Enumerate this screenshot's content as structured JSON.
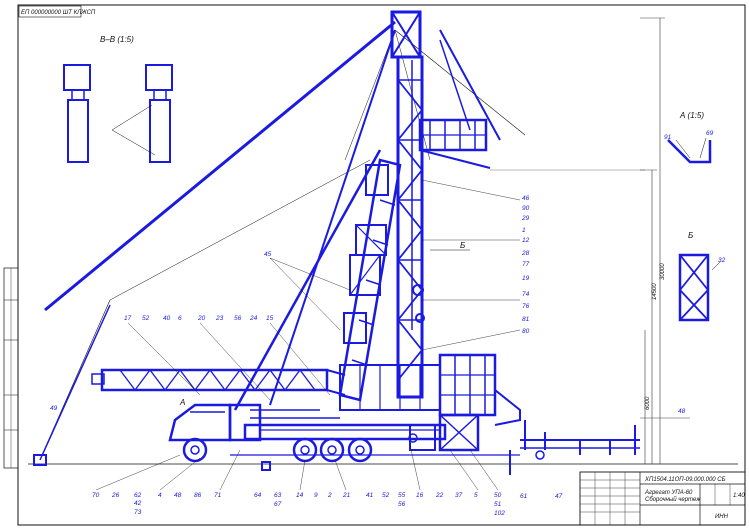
{
  "drawing": {
    "stamp_code": "ЕП 000000000 ШТ КЛЖСП",
    "view_bb": "В–В (1:5)",
    "view_a": "А (1:5)",
    "view_b": "Б",
    "mark_a": "А",
    "mark_b": "Б",
    "title_block": {
      "doc_number": "ХП1504.11ОП-09.000.000 СБ",
      "title_line1": "Агрегат УПА-60",
      "title_line2": "Сборочный чертеж",
      "sheet": "1:40",
      "org": "ИНН"
    },
    "dims": {
      "height_total": "30000",
      "height_mid": "14500",
      "height_low": "6000"
    },
    "labels": {
      "right_upper": [
        "46",
        "90",
        "29",
        "1",
        "12",
        "28",
        "77",
        "19",
        "74",
        "76",
        "81",
        "80"
      ],
      "right_misc": [
        "32",
        "69",
        "91",
        "48",
        "47",
        "61"
      ],
      "top_row": [
        "17",
        "52",
        "40",
        "6",
        "20",
        "23",
        "56",
        "24",
        "15",
        "45"
      ],
      "left": [
        "49",
        "A"
      ],
      "bottom_row": [
        "70",
        "26",
        "62",
        "42",
        "73",
        "4",
        "48",
        "86",
        "71",
        "64",
        "63",
        "67",
        "14",
        "9",
        "2",
        "21",
        "41",
        "52",
        "55",
        "56",
        "16",
        "22",
        "37",
        "5",
        "50",
        "51",
        "102"
      ]
    }
  },
  "colors": {
    "ink": "#1a1ae0",
    "frame": "#111111"
  }
}
